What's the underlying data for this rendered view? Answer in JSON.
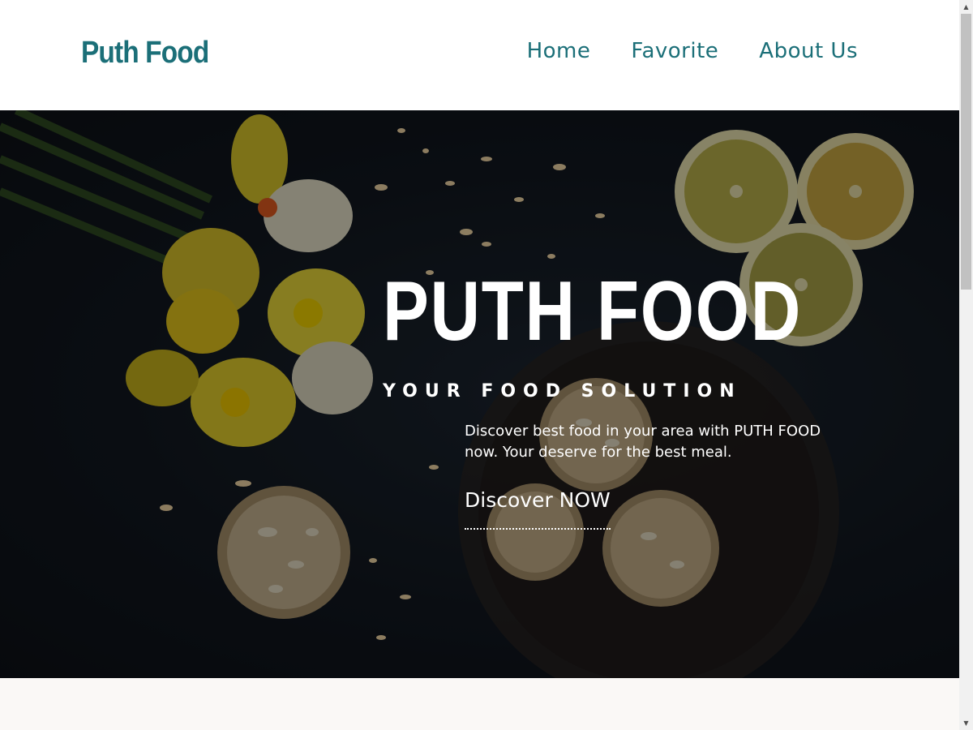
{
  "header": {
    "logo": "Puth Food",
    "nav": [
      {
        "label": "Home"
      },
      {
        "label": "Favorite"
      },
      {
        "label": "About Us"
      }
    ]
  },
  "hero": {
    "title": "PUTH FOOD",
    "subtitle": "YOUR FOOD SOLUTION",
    "description": "Discover best food in your area with PUTH FOOD now. Your deserve for the best meal.",
    "cta": "Discover NOW"
  },
  "colors": {
    "brand": "#1b6f78",
    "hero_bg": "#121820",
    "page_bg": "#faf8f6"
  },
  "scrollbar": {
    "up_icon": "chevron-up-icon",
    "down_icon": "chevron-down-icon"
  }
}
